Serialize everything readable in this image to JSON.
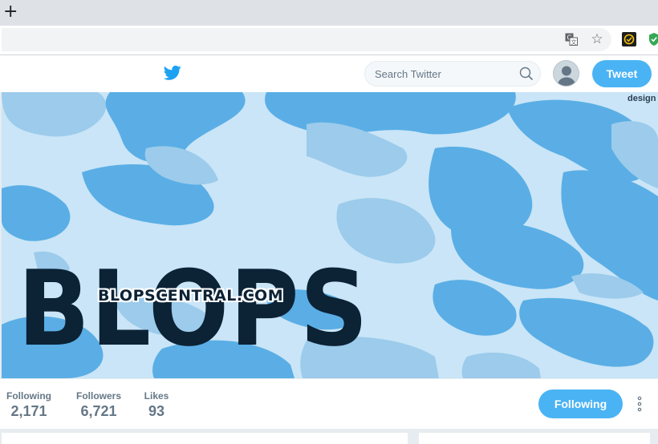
{
  "browser": {
    "new_tab_glyph": "+",
    "icons": [
      "translate-icon",
      "star-icon",
      "extension-icon",
      "shield-extension-icon"
    ]
  },
  "twitter_header": {
    "search_placeholder": "Search Twitter",
    "tweet_label": "Tweet",
    "brand_color": "#1da1f2",
    "button_color": "#4ab3f4"
  },
  "banner": {
    "title": "BLOPS",
    "url": "BLOPSCENTRAL.COM",
    "credit": "design"
  },
  "profile_stats": {
    "following_label": "Following",
    "following_value": "2,171",
    "followers_label": "Followers",
    "followers_value": "6,721",
    "likes_label": "Likes",
    "likes_value": "93"
  },
  "actions": {
    "following_button": "Following"
  }
}
